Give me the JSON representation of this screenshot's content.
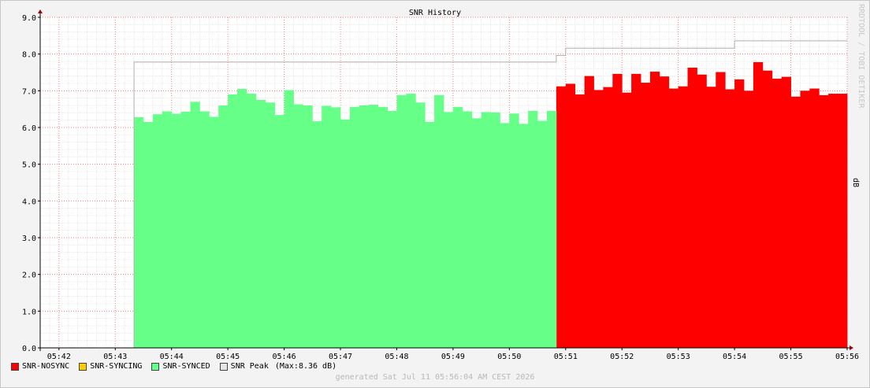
{
  "chart_data": {
    "type": "area",
    "title": "SNR History",
    "ylabel": "dB",
    "ylim": [
      0,
      9
    ],
    "yticks": [
      "0.0",
      "1.0",
      "2.0",
      "3.0",
      "4.0",
      "5.0",
      "6.0",
      "7.0",
      "8.0",
      "9.0"
    ],
    "xticks": [
      "05:42",
      "05:43",
      "05:44",
      "05:45",
      "05:46",
      "05:47",
      "05:48",
      "05:49",
      "05:50",
      "05:51",
      "05:52",
      "05:53",
      "05:54",
      "05:55",
      "05:56"
    ],
    "x_start": "05:41:40",
    "grid": true,
    "legend_position": "bottom-left",
    "series": [
      {
        "name": "SNR-NOSYNC",
        "color": "#ff0000",
        "start": "05:50:50",
        "step_seconds": 10,
        "values": [
          7.12,
          7.19,
          6.9,
          7.4,
          7.02,
          7.1,
          7.46,
          6.95,
          7.46,
          7.22,
          7.52,
          7.39,
          7.06,
          7.12,
          7.63,
          7.44,
          7.11,
          7.51,
          7.04,
          7.31,
          7.0,
          7.78,
          7.55,
          7.33,
          7.38,
          6.84,
          7.0,
          7.06,
          6.88,
          6.92,
          6.92
        ]
      },
      {
        "name": "SNR-SYNCING",
        "color": "#ffcc00",
        "values": []
      },
      {
        "name": "SNR-SYNCED",
        "color": "#66ff88",
        "start": "05:43:20",
        "step_seconds": 10,
        "values": [
          6.28,
          6.15,
          6.36,
          6.44,
          6.37,
          6.43,
          6.7,
          6.44,
          6.29,
          6.6,
          6.9,
          7.05,
          6.92,
          6.75,
          6.68,
          6.34,
          7.02,
          6.63,
          6.6,
          6.17,
          6.59,
          6.55,
          6.22,
          6.56,
          6.6,
          6.62,
          6.56,
          6.45,
          6.88,
          6.92,
          6.68,
          6.15,
          6.88,
          6.42,
          6.56,
          6.44,
          6.25,
          6.42,
          6.41,
          6.12,
          6.38,
          6.1,
          6.45,
          6.18,
          6.45
        ]
      },
      {
        "name": "SNR Peak",
        "color": "#c0c0c0",
        "type": "step-line",
        "points": [
          [
            "05:43:20",
            7.78
          ],
          [
            "05:50:50",
            7.96
          ],
          [
            "05:51:00",
            8.16
          ],
          [
            "05:54:00",
            8.36
          ],
          [
            "05:56:00",
            8.36
          ]
        ]
      }
    ]
  },
  "legend": {
    "nosync": "SNR-NOSYNC",
    "syncing": "SNR-SYNCING",
    "synced": "SNR-SYNCED",
    "peak": "SNR Peak",
    "peak_max": "(Max:8.36 dB)"
  },
  "watermark": "RRDTOOL / TOBI OETIKER",
  "footer": "generated Sat Jul 11 05:56:04 AM CEST 2026"
}
